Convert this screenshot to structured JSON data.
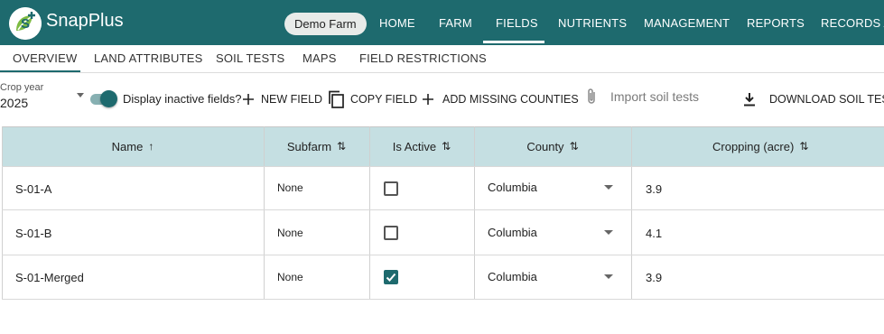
{
  "app": {
    "name": "SnapPlus",
    "farm": "Demo Farm"
  },
  "nav": {
    "items": [
      {
        "label": "HOME"
      },
      {
        "label": "FARM"
      },
      {
        "label": "FIELDS"
      },
      {
        "label": "NUTRIENTS"
      },
      {
        "label": "MANAGEMENT"
      },
      {
        "label": "REPORTS"
      },
      {
        "label": "RECORDS AN"
      }
    ],
    "active": "FIELDS"
  },
  "tabs": {
    "items": [
      {
        "label": "OVERVIEW"
      },
      {
        "label": "LAND ATTRIBUTES"
      },
      {
        "label": "SOIL TESTS"
      },
      {
        "label": "MAPS"
      },
      {
        "label": "FIELD RESTRICTIONS"
      }
    ],
    "active": "OVERVIEW"
  },
  "toolbar": {
    "crop_year_label": "Crop year",
    "crop_year_value": "2025",
    "inactive_toggle_label": "Display inactive fields?",
    "inactive_toggle_on": true,
    "new_field": "NEW FIELD",
    "copy_field": "COPY FIELD",
    "add_missing_counties": "ADD MISSING COUNTIES",
    "import_soil_tests": "Import soil tests",
    "download_soil_tests": "DOWNLOAD SOIL TEST"
  },
  "table": {
    "columns": [
      {
        "label": "Name",
        "sort": "↑"
      },
      {
        "label": "Subfarm",
        "sort": "⇅"
      },
      {
        "label": "Is Active",
        "sort": "⇅"
      },
      {
        "label": "County",
        "sort": "⇅"
      },
      {
        "label": "Cropping (acre)",
        "sort": "⇅"
      }
    ],
    "rows": [
      {
        "name": "S-01-A",
        "subfarm": "None",
        "active": false,
        "county": "Columbia",
        "cropping": "3.9"
      },
      {
        "name": "S-01-B",
        "subfarm": "None",
        "active": false,
        "county": "Columbia",
        "cropping": "4.1"
      },
      {
        "name": "S-01-Merged",
        "subfarm": "None",
        "active": true,
        "county": "Columbia",
        "cropping": "3.9"
      }
    ]
  },
  "colors": {
    "primary": "#1e6a6e",
    "header_bg": "#c5dfe2",
    "pill_bg": "#e8ebe9"
  },
  "icons": [
    "snapplus-logo",
    "plus-icon",
    "copy-icon",
    "paperclip-icon",
    "download-icon",
    "sort-up-icon",
    "sort-both-icon",
    "dropdown-caret-icon",
    "checkbox-icon"
  ]
}
